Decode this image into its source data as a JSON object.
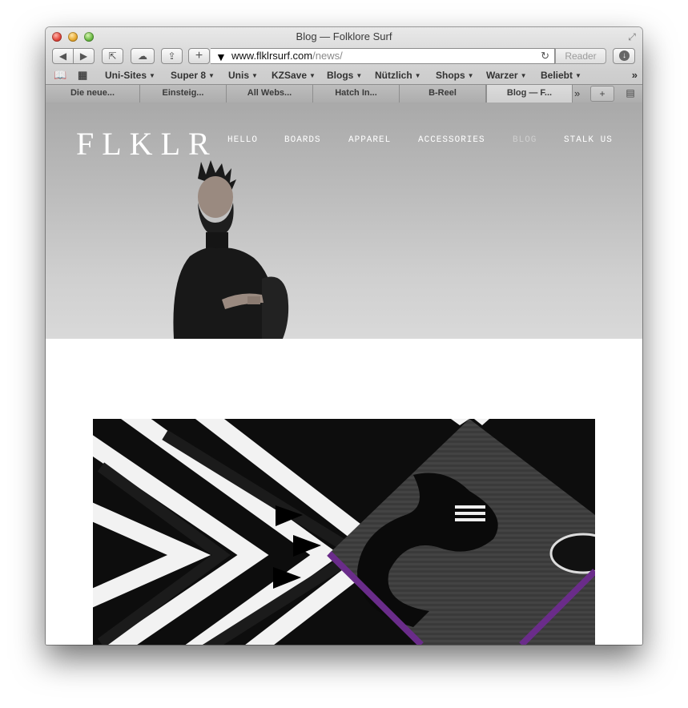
{
  "window": {
    "title": "Blog — Folklore Surf"
  },
  "toolbar": {
    "url_host": "www.flklrsurf.com",
    "url_path": "/news/",
    "reader_label": "Reader",
    "add_label": "+"
  },
  "bookmarks": [
    {
      "label": "Uni-Sites"
    },
    {
      "label": "Super 8"
    },
    {
      "label": "Unis"
    },
    {
      "label": "KZSave"
    },
    {
      "label": "Blogs"
    },
    {
      "label": "Nützlich"
    },
    {
      "label": "Shops"
    },
    {
      "label": "Warzer"
    },
    {
      "label": "Beliebt"
    }
  ],
  "tabs": [
    {
      "label": "Die neue..."
    },
    {
      "label": "Einsteig..."
    },
    {
      "label": "All Webs..."
    },
    {
      "label": "Hatch In..."
    },
    {
      "label": "B-Reel"
    },
    {
      "label": "Blog — F..."
    }
  ],
  "site": {
    "logo": "FLKLR",
    "nav": [
      "HELLO",
      "BOARDS",
      "APPAREL",
      "ACCESSORIES",
      "BLOG",
      "STALK US"
    ]
  },
  "colors": {
    "accent_purple": "#6a2c8a",
    "hero_gray": "#bdbdbd"
  }
}
